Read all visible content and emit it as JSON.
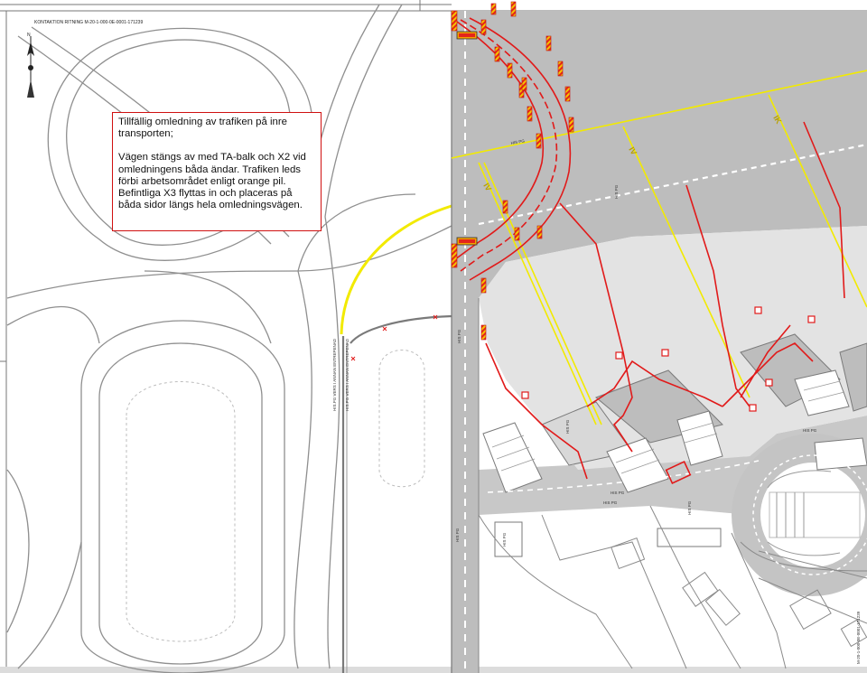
{
  "drawing_ref": "KONTAKTION RITNING M-20-1-000-0E-0001-171239",
  "drawing_ref_side": "M-20-1-000-0E-0001-171239",
  "note": {
    "line1": "Tillfällig omledning av trafiken på inre transporten;",
    "line2": "Vägen stängs av med TA-balk och X2 vid omledningens båda ändar. Trafiken leds förbi arbetsområdet enligt orange pil. Befintliga X3 flyttas in och placeras på båda sidor längs hela omledningsvägen."
  },
  "north_label": "N",
  "road_labels": {
    "left_a": "HIS.PG VERS I ANNAN ENTREPENAD",
    "left_b": "HIS.PG VERS I ANNAN ENTREPENAD"
  },
  "section_labels": [
    "IV",
    "IV",
    "IK"
  ],
  "colors": {
    "asphalt": "#bdbdbd",
    "light_area": "#e3e3e3",
    "detour_red": "#e11a1a",
    "utility_yellow": "#f2ea00",
    "barrier_red": "#e4251b",
    "barrier_yellow": "#f5c400",
    "linework": "#8a8a8a"
  }
}
